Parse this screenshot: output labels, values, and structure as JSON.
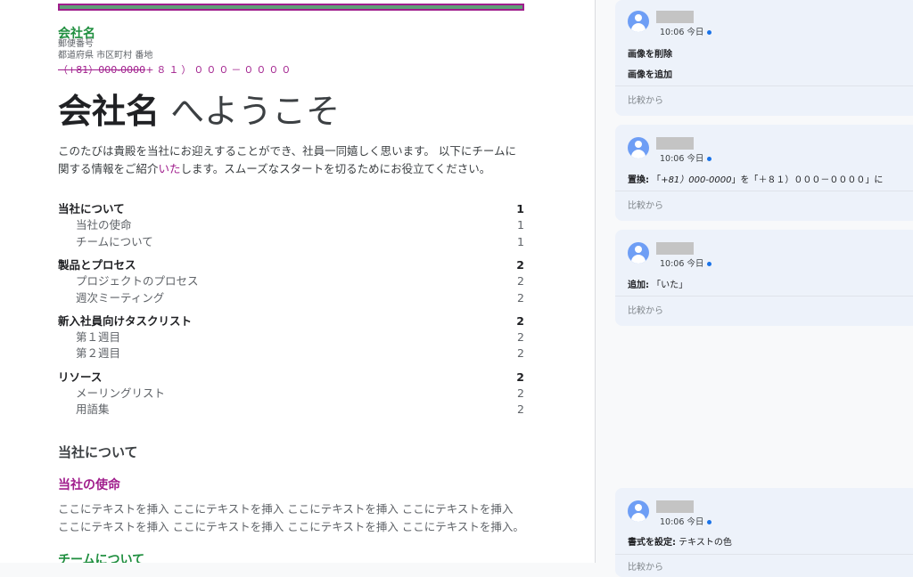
{
  "document": {
    "company_name": "会社名",
    "postal_code": "郵便番号",
    "address": "都道府県 市区町村 番地",
    "phone_deleted": "（+81）000-0000",
    "phone_inserted": "+８１）０００－００００",
    "title_bold": "会社名",
    "title_rest": " へようこそ",
    "intro_before": "このたびは貴殿を当社にお迎えすることができ、社員一同嬉しく思います。 以下にチームに関する情報をご紹介",
    "intro_inserted": "いた",
    "intro_after": "します。スムーズなスタートを切るためにお役立てください。",
    "toc": [
      {
        "type": "heading",
        "label": "当社について",
        "page": "1"
      },
      {
        "type": "sub",
        "label": "当社の使命",
        "page": "1"
      },
      {
        "type": "sub",
        "label": "チームについて",
        "page": "1"
      },
      {
        "type": "heading",
        "label": "製品とプロセス",
        "page": "2"
      },
      {
        "type": "sub",
        "label": "プロジェクトのプロセス",
        "page": "2"
      },
      {
        "type": "sub",
        "label": "週次ミーティング",
        "page": "2"
      },
      {
        "type": "heading",
        "label": "新入社員向けタスクリスト",
        "page": "2"
      },
      {
        "type": "sub",
        "label": "第１週目",
        "page": "2"
      },
      {
        "type": "sub",
        "label": "第２週目",
        "page": "2"
      },
      {
        "type": "heading",
        "label": "リソース",
        "page": "2"
      },
      {
        "type": "sub",
        "label": "メーリングリスト",
        "page": "2"
      },
      {
        "type": "sub",
        "label": "用語集",
        "page": "2"
      }
    ],
    "section_about": "当社について",
    "section_mission": "当社の使命",
    "mission_text": "ここにテキストを挿入 ここにテキストを挿入 ここにテキストを挿入 ここにテキストを挿入 ここにテキストを挿入 ここにテキストを挿入 ここにテキストを挿入 ここにテキストを挿入。",
    "section_team": "チームについて"
  },
  "suggestions": [
    {
      "time": "10:06 今日",
      "line1_bold": "画像を削除",
      "line2_bold": "画像を追加",
      "compare": "比較から"
    },
    {
      "time": "10:06 今日",
      "prefix": "置換:",
      "open1": " 「",
      "old_value": "+81）000-0000",
      "mid": "」を「",
      "new_value": "＋８１）０００－００００",
      "close": "」に",
      "compare": "比較から"
    },
    {
      "time": "10:06 今日",
      "prefix": "追加:",
      "value": " 「いた」",
      "compare": "比較から"
    },
    {
      "time": "10:06 今日",
      "prefix": "書式を設定:",
      "value": " テキストの色",
      "compare": "比較から"
    }
  ],
  "colors": {
    "insert_accent": "#a01d8c",
    "company_green": "#1e8e3e",
    "avatar_blue": "#6e9ef5",
    "online_dot": "#1a73e8"
  }
}
